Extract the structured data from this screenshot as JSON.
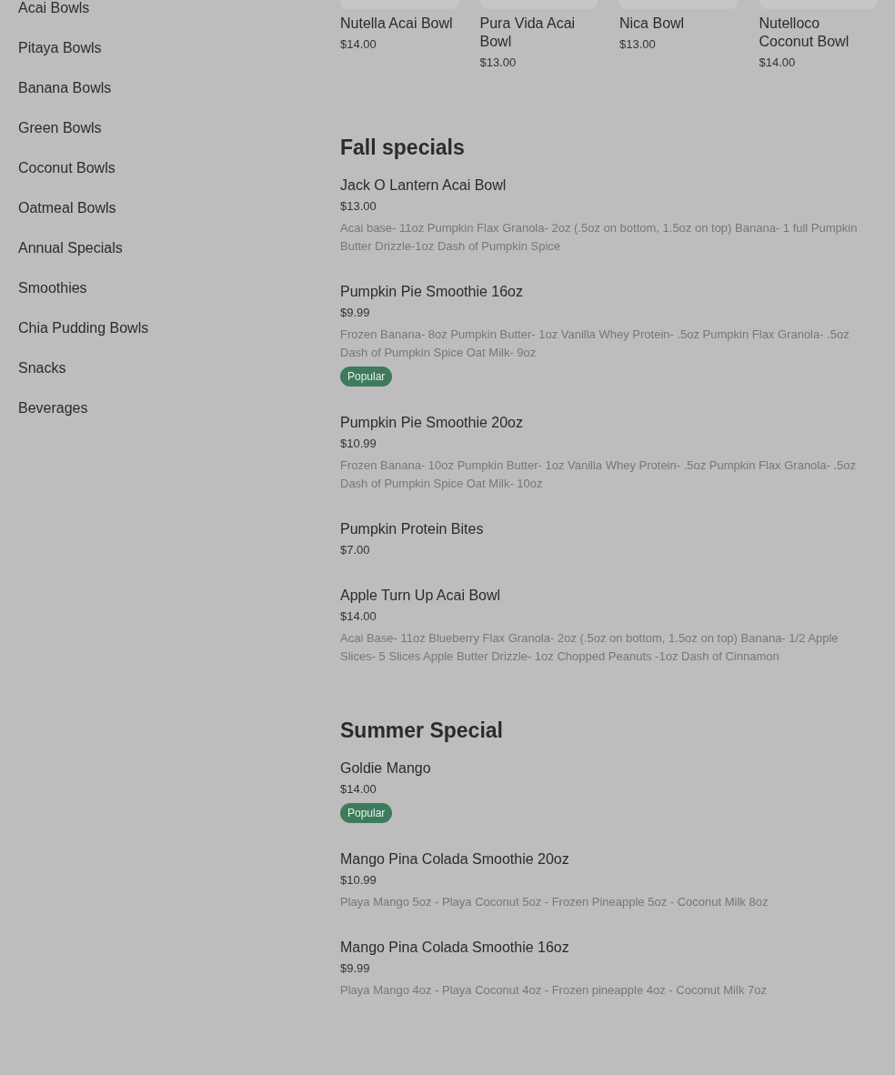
{
  "sidebar": {
    "items": [
      "Acai Bowls",
      "Pitaya Bowls",
      "Banana Bowls",
      "Green Bowls",
      "Coconut Bowls",
      "Oatmeal Bowls",
      "Annual Specials",
      "Smoothies",
      "Chia Pudding Bowls",
      "Snacks",
      "Beverages"
    ]
  },
  "featured": {
    "items": [
      {
        "name": "Nutella Acai Bowl",
        "price": "$14.00"
      },
      {
        "name": "Pura Vida Acai Bowl",
        "price": "$13.00"
      },
      {
        "name": "Nica Bowl",
        "price": "$13.00"
      },
      {
        "name": "Nutelloco Coconut Bowl",
        "price": "$14.00"
      }
    ]
  },
  "sections": [
    {
      "title": "Fall specials",
      "items": [
        {
          "name": "Jack O Lantern Acai Bowl",
          "price": "$13.00",
          "description": "Acai base- 11oz Pumpkin Flax Granola- 2oz (.5oz on bottom, 1.5oz on top) Banana- 1 full Pumpkin Butter Drizzle-1oz Dash of Pumpkin Spice"
        },
        {
          "name": "Pumpkin Pie Smoothie 16oz",
          "price": "$9.99",
          "description": "Frozen Banana- 8oz Pumpkin Butter- 1oz Vanilla Whey Protein- .5oz Pumpkin Flax Granola- .5oz Dash of Pumpkin Spice Oat Milk- 9oz",
          "badge": "Popular"
        },
        {
          "name": "Pumpkin Pie Smoothie 20oz",
          "price": "$10.99",
          "description": "Frozen Banana- 10oz Pumpkin Butter- 1oz Vanilla Whey Protein- .5oz Pumpkin Flax Granola- .5oz Dash of Pumpkin Spice Oat Milk- 10oz"
        },
        {
          "name": "Pumpkin Protein Bites",
          "price": "$7.00"
        },
        {
          "name": "Apple Turn Up Acai Bowl",
          "price": "$14.00",
          "description": "Acai Base- 11oz Blueberry Flax Granola- 2oz (.5oz on bottom, 1.5oz on top) Banana- 1/2 Apple Slices- 5 Slices Apple Butter Drizzle- 1oz Chopped Peanuts -1oz Dash of Cinnamon"
        }
      ]
    },
    {
      "title": "Summer Special",
      "items": [
        {
          "name": "Goldie Mango",
          "price": "$14.00",
          "badge": "Popular"
        },
        {
          "name": "Mango Pina Colada Smoothie 20oz",
          "price": "$10.99",
          "description": "Playa Mango 5oz - Playa Coconut 5oz - Frozen Pineapple 5oz - Coconut Milk 8oz"
        },
        {
          "name": "Mango Pina Colada Smoothie 16oz",
          "price": "$9.99",
          "description": "Playa Mango 4oz - Playa Coconut 4oz - Frozen pineapple 4oz - Coconut Milk 7oz"
        }
      ]
    }
  ]
}
